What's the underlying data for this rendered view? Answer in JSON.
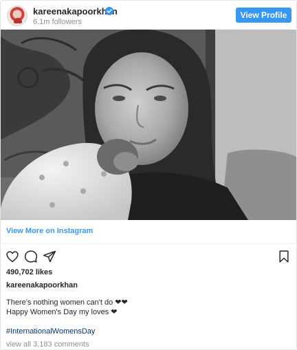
{
  "header": {
    "username": "kareenakapoorkhan",
    "followers": "6.1m followers",
    "view_profile_label": "View Profile",
    "verified_icon": "verified-badge-icon"
  },
  "post": {
    "image_alt": "kareenakapoorkhan photo",
    "view_more_label": "View More on Instagram",
    "likes": "490,702 likes",
    "caption_username": "kareenakapoorkhan",
    "caption_line1": "There's nothing women can't do ❤❤",
    "caption_line2": "Happy Women's Day my loves ❤",
    "hashtag": "#InternationalWomensDay",
    "comments_link": "view all 3,183 comments"
  },
  "icons": {
    "like": "heart-icon",
    "comment": "comment-icon",
    "share": "share-icon",
    "save": "bookmark-icon"
  },
  "colors": {
    "accent": "#3897f0",
    "hashtag": "#003569",
    "muted": "#8e8e8e"
  }
}
